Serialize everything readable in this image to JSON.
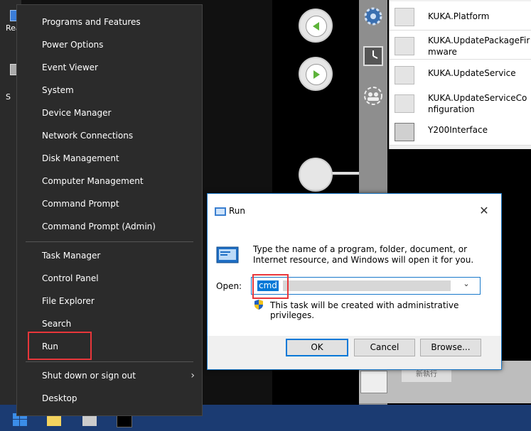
{
  "desktop": {
    "icon_labels": [
      "Rea",
      "S"
    ]
  },
  "winx_menu": {
    "items": [
      {
        "label": "Programs and Features"
      },
      {
        "label": "Power Options"
      },
      {
        "label": "Event Viewer"
      },
      {
        "label": "System"
      },
      {
        "label": "Device Manager"
      },
      {
        "label": "Network Connections"
      },
      {
        "label": "Disk Management"
      },
      {
        "label": "Computer Management"
      },
      {
        "label": "Command Prompt"
      },
      {
        "label": "Command Prompt (Admin)"
      },
      {
        "label": "Task Manager"
      },
      {
        "label": "Control Panel"
      },
      {
        "label": "File Explorer"
      },
      {
        "label": "Search"
      },
      {
        "label": "Run"
      },
      {
        "label": "Shut down or sign out"
      },
      {
        "label": "Desktop"
      }
    ]
  },
  "kuka": {
    "list": [
      {
        "name": "KUKA.Platform"
      },
      {
        "name": "KUKA.UpdatePackageFirmware"
      },
      {
        "name": "KUKA.UpdateService"
      },
      {
        "name": "KUKA.UpdateServiceConfiguration"
      },
      {
        "name": "Y200Interface"
      }
    ],
    "bottom_text": "新執行"
  },
  "run_dialog": {
    "title": "Run",
    "description": "Type the name of a program, folder, document, or Internet resource, and Windows will open it for you.",
    "open_label": "Open:",
    "open_value": "cmd",
    "admin_note": "This task will be created with administrative privileges.",
    "buttons": {
      "ok": "OK",
      "cancel": "Cancel",
      "browse": "Browse..."
    }
  },
  "colors": {
    "accent": "#0078d7",
    "highlight": "#e8363a",
    "menu_bg": "#2b2b2b",
    "taskbar_bg": "#1b3b72"
  }
}
